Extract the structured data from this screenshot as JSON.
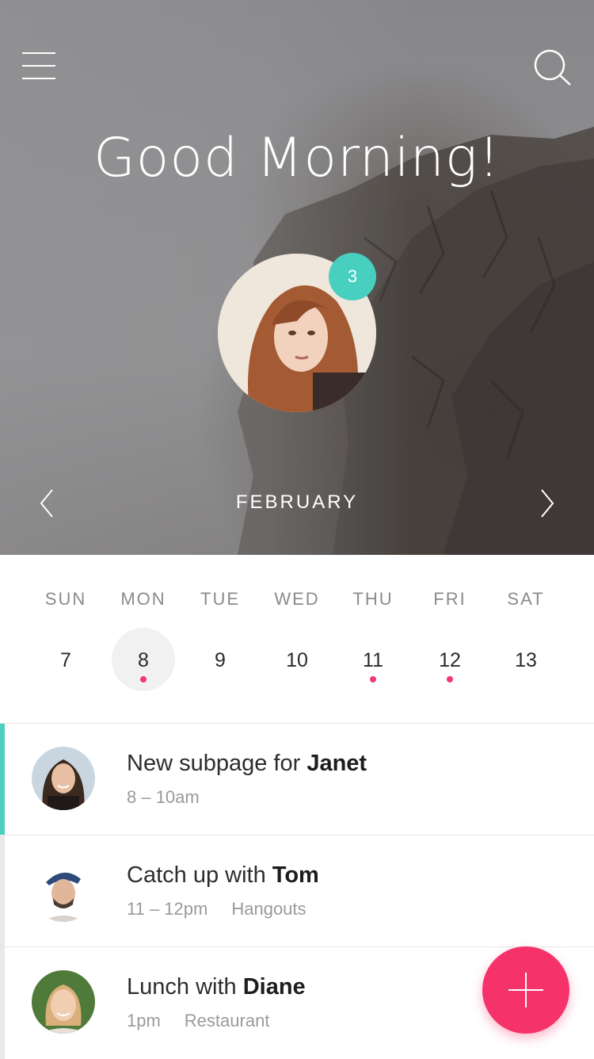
{
  "header": {
    "greeting": "Good Morning!",
    "notification_count": "3",
    "menu_icon": "hamburger-icon",
    "search_icon": "search-icon"
  },
  "calendar": {
    "month": "FEBRUARY",
    "days": [
      {
        "name": "SUN",
        "date": "7",
        "selected": false,
        "has_event": false
      },
      {
        "name": "MON",
        "date": "8",
        "selected": true,
        "has_event": true
      },
      {
        "name": "TUE",
        "date": "9",
        "selected": false,
        "has_event": false
      },
      {
        "name": "WED",
        "date": "10",
        "selected": false,
        "has_event": false
      },
      {
        "name": "THU",
        "date": "11",
        "selected": false,
        "has_event": true
      },
      {
        "name": "FRI",
        "date": "12",
        "selected": false,
        "has_event": true
      },
      {
        "name": "SAT",
        "date": "13",
        "selected": false,
        "has_event": false
      }
    ]
  },
  "events": [
    {
      "title_prefix": "New subpage for",
      "title_name": "Janet",
      "time": "8 – 10am",
      "place": "",
      "active": true
    },
    {
      "title_prefix": "Catch up with",
      "title_name": "Tom",
      "time": "11 – 12pm",
      "place": "Hangouts",
      "active": false
    },
    {
      "title_prefix": "Lunch with",
      "title_name": "Diane",
      "time": "1pm",
      "place": "Restaurant",
      "active": false
    }
  ],
  "colors": {
    "accent_teal": "#47cfbf",
    "accent_pink": "#f5336a",
    "event_dot": "#f23a6e"
  }
}
